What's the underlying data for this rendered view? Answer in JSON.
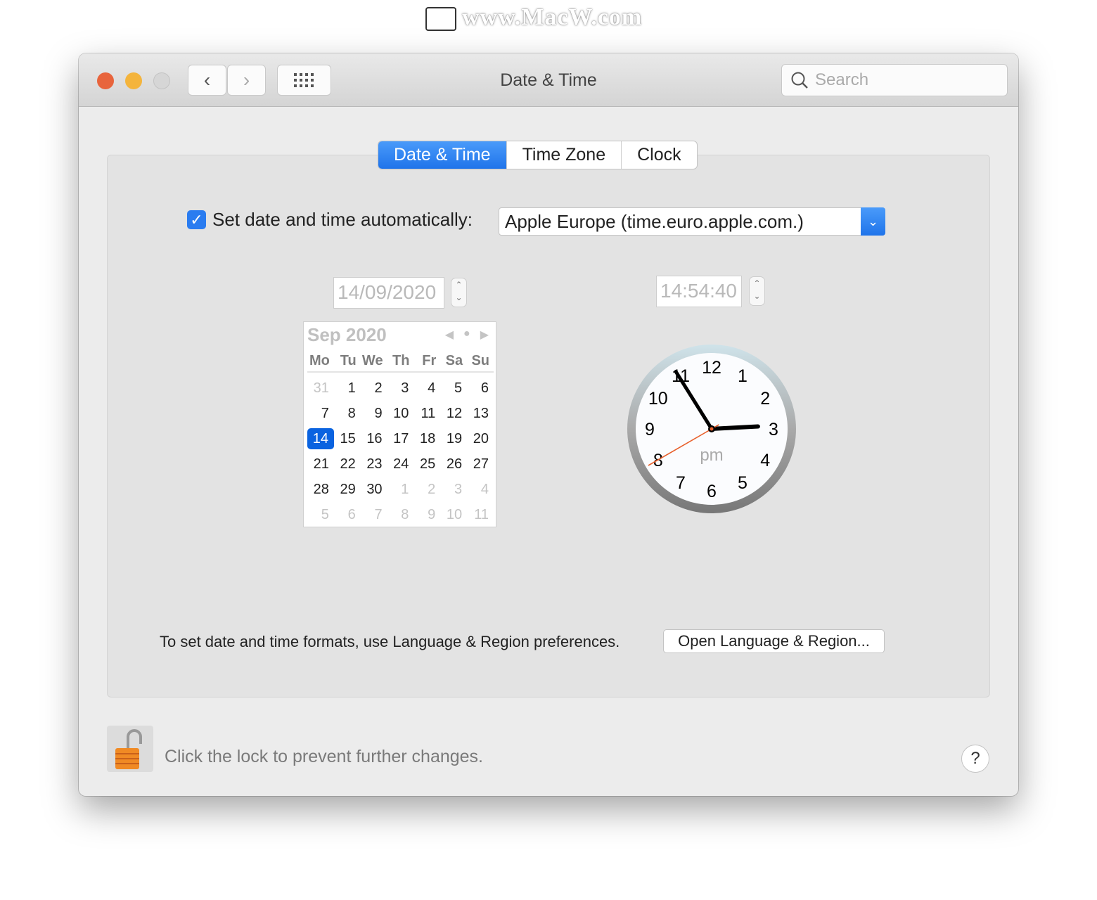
{
  "watermark": "www.MacW.com",
  "window": {
    "title": "Date & Time",
    "search_placeholder": "Search"
  },
  "tabs": [
    {
      "label": "Date & Time",
      "active": true
    },
    {
      "label": "Time Zone"
    },
    {
      "label": "Clock"
    }
  ],
  "auto": {
    "label": "Set date and time automatically:",
    "checked": true,
    "server": "Apple Europe (time.euro.apple.com.)"
  },
  "date_field": "14/09/2020",
  "time_field": "14:54:40",
  "calendar": {
    "title": "Sep 2020",
    "weekdays": [
      "Mo",
      "Tu",
      "We",
      "Th",
      "Fr",
      "Sa",
      "Su"
    ],
    "days": [
      [
        "31",
        1
      ],
      [
        "1"
      ],
      [
        "2"
      ],
      [
        "3"
      ],
      [
        "4"
      ],
      [
        "5"
      ],
      [
        "6"
      ],
      [
        "7"
      ],
      [
        "8"
      ],
      [
        "9"
      ],
      [
        "10"
      ],
      [
        "11"
      ],
      [
        "12"
      ],
      [
        "13"
      ],
      [
        "14",
        0,
        1
      ],
      [
        "15"
      ],
      [
        "16"
      ],
      [
        "17"
      ],
      [
        "18"
      ],
      [
        "19"
      ],
      [
        "20"
      ],
      [
        "21"
      ],
      [
        "22"
      ],
      [
        "23"
      ],
      [
        "24"
      ],
      [
        "25"
      ],
      [
        "26"
      ],
      [
        "27"
      ],
      [
        "28"
      ],
      [
        "29"
      ],
      [
        "30"
      ],
      [
        "1",
        1
      ],
      [
        "2",
        1
      ],
      [
        "3",
        1
      ],
      [
        "4",
        1
      ],
      [
        "5",
        1
      ],
      [
        "6",
        1
      ],
      [
        "7",
        1
      ],
      [
        "8",
        1
      ],
      [
        "9",
        1
      ],
      [
        "10",
        1
      ],
      [
        "11",
        1
      ]
    ]
  },
  "clock": {
    "numbers": [
      "12",
      "1",
      "2",
      "3",
      "4",
      "5",
      "6",
      "7",
      "8",
      "9",
      "10",
      "11"
    ],
    "period": "pm",
    "hour": 14,
    "minute": 54,
    "second": 40,
    "second_hand_color": "#e8602c"
  },
  "formats_note": "To set date and time formats, use Language & Region preferences.",
  "open_button": "Open Language & Region...",
  "lock_text": "Click the lock to prevent further changes.",
  "help": "?"
}
